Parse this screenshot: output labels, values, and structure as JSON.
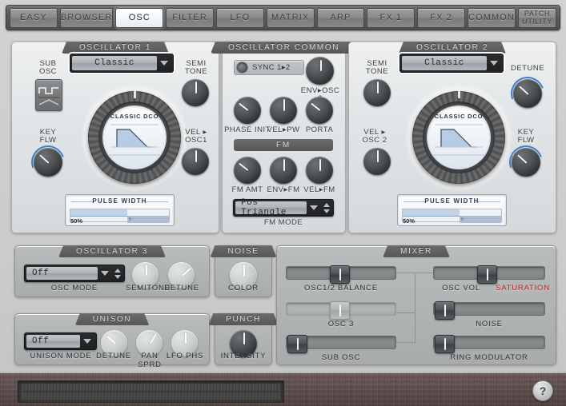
{
  "tabs": [
    {
      "label": "EASY",
      "active": false
    },
    {
      "label": "BROWSER",
      "active": false
    },
    {
      "label": "OSC",
      "active": true
    },
    {
      "label": "FILTER",
      "active": false
    },
    {
      "label": "LFO",
      "active": false
    },
    {
      "label": "MATRIX",
      "active": false
    },
    {
      "label": "ARP",
      "active": false
    },
    {
      "label": "FX 1",
      "active": false
    },
    {
      "label": "FX 2",
      "active": false
    },
    {
      "label": "COMMON",
      "active": false
    }
  ],
  "patch_utility": {
    "line1": "PATCH",
    "line2": "UTILITY"
  },
  "osc1": {
    "title": "OSCILLATOR 1",
    "sub_osc_label_l1": "SUB",
    "sub_osc_label_l2": "OSC",
    "wave_select": "Classic",
    "dco_label": "CLASSIC DCO",
    "semitone_l1": "SEMI",
    "semitone_l2": "TONE",
    "keyflw_l1": "KEY",
    "keyflw_l2": "FLW",
    "vel_l1": "VEL ▸",
    "vel_l2": "OSC1",
    "pulse_width_title": "PULSE WIDTH",
    "pulse_width_value": "50%"
  },
  "osc_common": {
    "title": "OSCILLATOR COMMON",
    "sync_label": "SYNC 1▸2",
    "env_osc2": "ENV▸OSC 2",
    "phase_init": "PHASE INIT",
    "vel_pw": "VEL▸PW",
    "porta": "PORTA",
    "fm_title": "FM",
    "fm_amt": "FM AMT",
    "env_fm": "ENV▸FM",
    "vel_fm": "VEL▸FM",
    "fm_mode_value": "Pos Triangle",
    "fm_mode_label": "FM MODE"
  },
  "osc2": {
    "title": "OSCILLATOR 2",
    "wave_select": "Classic",
    "dco_label": "CLASSIC DCO",
    "semitone_l1": "SEMI",
    "semitone_l2": "TONE",
    "detune": "DETUNE",
    "keyflw_l1": "KEY",
    "keyflw_l2": "FLW",
    "vel_l1": "VEL ▸",
    "vel_l2": "OSC 2",
    "pulse_width_title": "PULSE WIDTH",
    "pulse_width_value": "50%"
  },
  "osc3": {
    "title": "OSCILLATOR 3",
    "mode_value": "Off",
    "mode_label": "OSC MODE",
    "semitone": "SEMITONE",
    "detune": "DETUNE"
  },
  "unison": {
    "title": "UNISON",
    "mode_value": "Off",
    "mode_label": "UNISON MODE",
    "detune": "DETUNE",
    "pan_sprd": "PAN SPRD",
    "lfo_phs": "LFO PHS"
  },
  "noise": {
    "title": "NOISE",
    "color": "COLOR"
  },
  "punch": {
    "title": "PUNCH",
    "intensity": "INTENSITY"
  },
  "mixer": {
    "title": "MIXER",
    "osc12_balance": "OSC1/2 BALANCE",
    "osc3": "OSC 3",
    "sub_osc": "SUB OSC",
    "osc_vol": "OSC VOL",
    "saturation": "SATURATION",
    "noise": "NOISE",
    "ring_modulator": "RING MODULATOR"
  },
  "footer": {
    "help": "?"
  },
  "colors": {
    "accent_blue": "#3e7fd0",
    "saturation_red": "#b62626",
    "panel_light": "#e2e5e7",
    "panel_grey": "#b1b4b5",
    "tab_active": "#ffffff"
  }
}
